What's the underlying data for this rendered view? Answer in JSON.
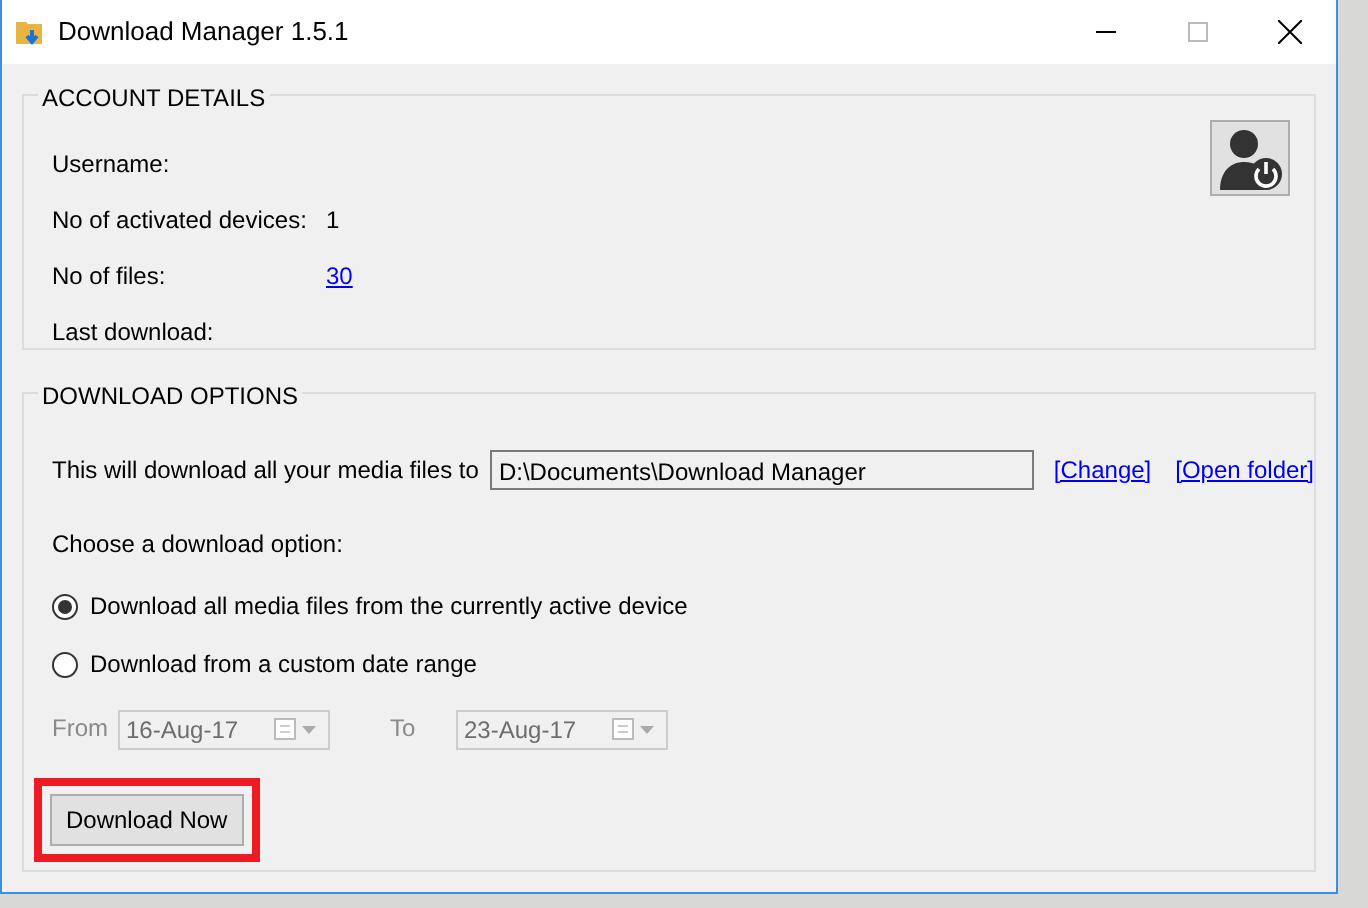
{
  "window": {
    "title": "Download Manager 1.5.1"
  },
  "account": {
    "heading": "ACCOUNT DETAILS",
    "fields": [
      {
        "label": "Username:"
      },
      {
        "label": "No of activated devices:",
        "value": "1",
        "kind": "text"
      },
      {
        "label": "No of files:",
        "value": "30",
        "kind": "link"
      },
      {
        "label": "Last download:"
      }
    ]
  },
  "download_options": {
    "heading": "DOWNLOAD OPTIONS",
    "folder_label": "This will download all your media files to",
    "folder_value": "D:\\Documents\\Download Manager",
    "links": [
      "[Change]",
      "[Open folder]"
    ],
    "choose_label": "Choose a download option:",
    "options": [
      {
        "label": "Download all media files from the currently active device",
        "selected": true
      },
      {
        "label": "Download from a custom date range",
        "selected": false
      }
    ],
    "date_range": {
      "disabled": true,
      "from_label": "From",
      "from_value": "16-Aug-17",
      "to_label": "To",
      "to_value": "23-Aug-17"
    },
    "download_button": {
      "label": "Download Now",
      "highlighted": true
    }
  }
}
